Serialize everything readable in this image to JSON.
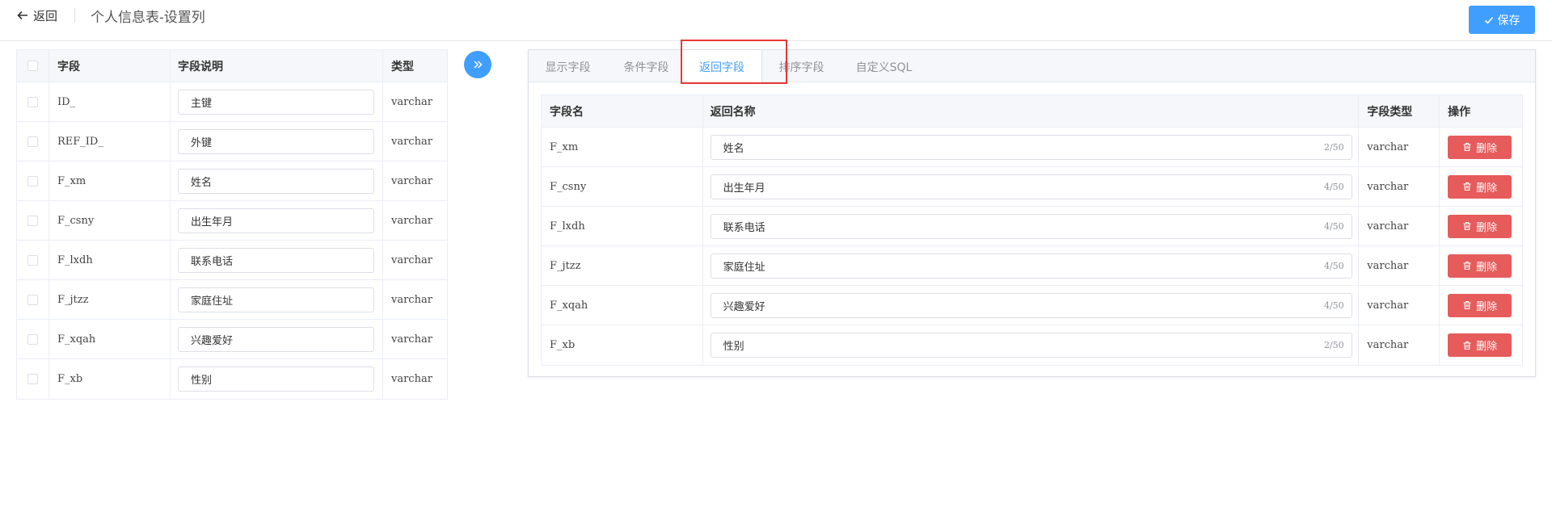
{
  "header": {
    "back_label": "返回",
    "title": "个人信息表-设置列",
    "save_label": "保存"
  },
  "left_table": {
    "headers": {
      "field": "字段",
      "desc": "字段说明",
      "type": "类型"
    },
    "rows": [
      {
        "field": "ID_",
        "desc": "主键",
        "type": "varchar"
      },
      {
        "field": "REF_ID_",
        "desc": "外键",
        "type": "varchar"
      },
      {
        "field": "F_xm",
        "desc": "姓名",
        "type": "varchar"
      },
      {
        "field": "F_csny",
        "desc": "出生年月",
        "type": "varchar"
      },
      {
        "field": "F_lxdh",
        "desc": "联系电话",
        "type": "varchar"
      },
      {
        "field": "F_jtzz",
        "desc": "家庭住址",
        "type": "varchar"
      },
      {
        "field": "F_xqah",
        "desc": "兴趣爱好",
        "type": "varchar"
      },
      {
        "field": "F_xb",
        "desc": "性别",
        "type": "varchar"
      }
    ]
  },
  "tabs": [
    {
      "label": "显示字段",
      "active": false
    },
    {
      "label": "条件字段",
      "active": false
    },
    {
      "label": "返回字段",
      "active": true
    },
    {
      "label": "排序字段",
      "active": false
    },
    {
      "label": "自定义SQL",
      "active": false
    }
  ],
  "right_table": {
    "headers": {
      "name": "字段名",
      "ret": "返回名称",
      "type": "字段类型",
      "op": "操作"
    },
    "delete_label": "删除",
    "rows": [
      {
        "name": "F_xm",
        "ret": "姓名",
        "count": "2/50",
        "type": "varchar"
      },
      {
        "name": "F_csny",
        "ret": "出生年月",
        "count": "4/50",
        "type": "varchar"
      },
      {
        "name": "F_lxdh",
        "ret": "联系电话",
        "count": "4/50",
        "type": "varchar"
      },
      {
        "name": "F_jtzz",
        "ret": "家庭住址",
        "count": "4/50",
        "type": "varchar"
      },
      {
        "name": "F_xqah",
        "ret": "兴趣爱好",
        "count": "4/50",
        "type": "varchar"
      },
      {
        "name": "F_xb",
        "ret": "性别",
        "count": "2/50",
        "type": "varchar"
      }
    ]
  },
  "colors": {
    "primary": "#409eff",
    "danger": "#e65b5b",
    "highlight": "#e53935"
  }
}
